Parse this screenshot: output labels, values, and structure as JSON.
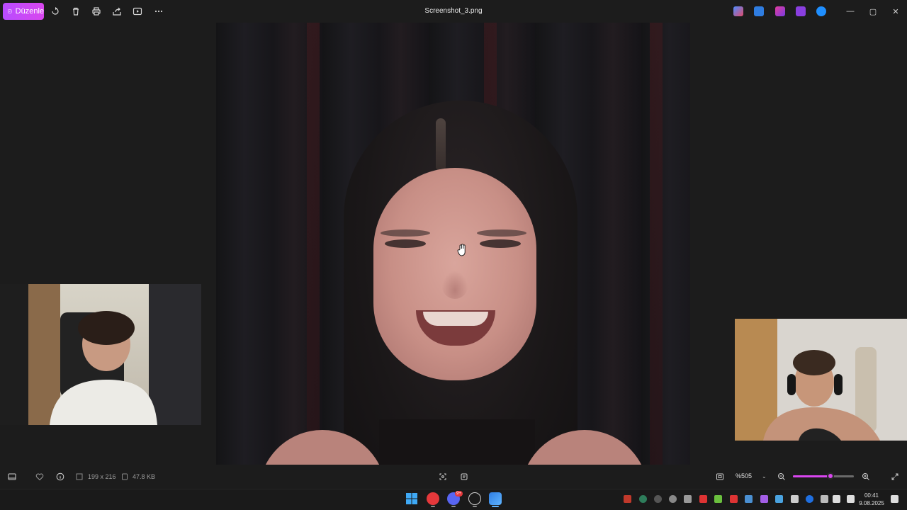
{
  "toolbar": {
    "edit_label": "Düzenle",
    "title": "Screenshot_3.png",
    "icons": [
      "rotate-icon",
      "delete-icon",
      "print-icon",
      "share-icon",
      "slideshow-icon",
      "more-icon"
    ]
  },
  "status": {
    "dimensions": "199 x 216",
    "file_size": "47.8 KB",
    "zoom_label": "%505",
    "zoom_fraction": 0.62
  },
  "taskbar": {
    "time": "00:41",
    "date": "9.08.2025",
    "discord_badge": "9+"
  },
  "colors": {
    "accent": "#d946ef",
    "background": "#1c1c1c"
  }
}
